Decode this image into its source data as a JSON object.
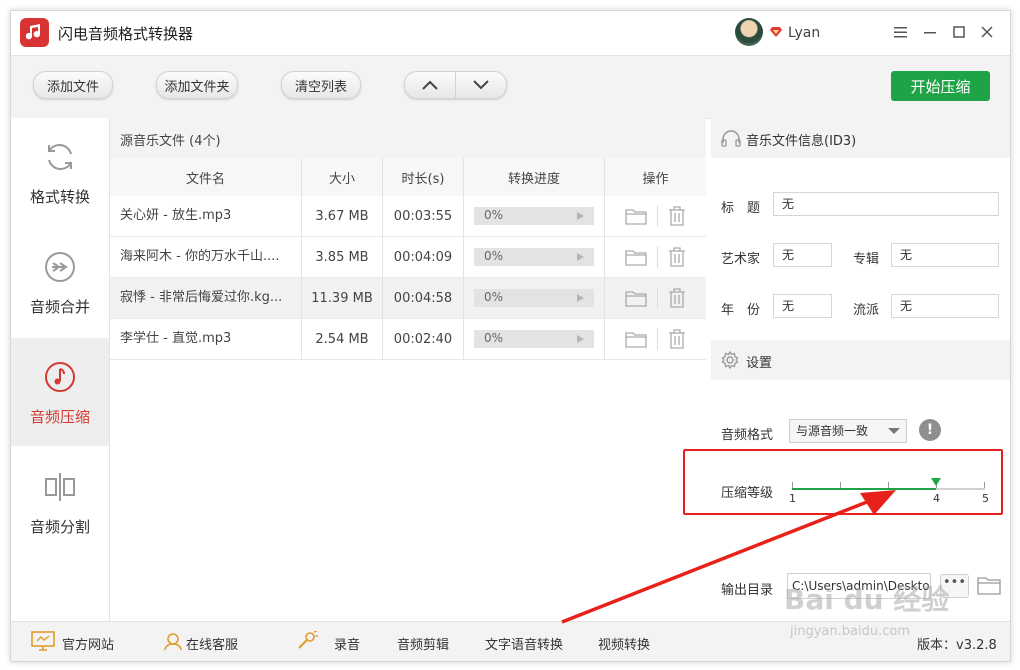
{
  "app": {
    "title": "闪电音频格式转换器",
    "user": "Lyan"
  },
  "toolbar": {
    "add_file": "添加文件",
    "add_folder": "添加文件夹",
    "clear_list": "清空列表",
    "start": "开始压缩"
  },
  "sidebar": {
    "items": [
      {
        "label": "格式转换"
      },
      {
        "label": "音频合并"
      },
      {
        "label": "音频压缩"
      },
      {
        "label": "音频分割"
      }
    ]
  },
  "filelist": {
    "title": "源音乐文件 (4个)",
    "columns": [
      "文件名",
      "大小",
      "时长(s)",
      "转换进度",
      "操作"
    ],
    "rows": [
      {
        "name": "关心妍 - 放生.mp3",
        "size": "3.67 MB",
        "duration": "00:03:55",
        "progress": "0%"
      },
      {
        "name": "海来阿木 - 你的万水千山....",
        "size": "3.85 MB",
        "duration": "00:04:09",
        "progress": "0%"
      },
      {
        "name": "寂悸 - 非常后悔爱过你.kg...",
        "size": "11.39 MB",
        "duration": "00:04:58",
        "progress": "0%"
      },
      {
        "name": "李学仕 - 直觉.mp3",
        "size": "2.54 MB",
        "duration": "00:02:40",
        "progress": "0%"
      }
    ]
  },
  "id3": {
    "header": "音乐文件信息(ID3)",
    "title_label": "标　题",
    "title_value": "无",
    "artist_label": "艺术家",
    "artist_value": "无",
    "album_label": "专辑",
    "album_value": "无",
    "year_label": "年　份",
    "year_value": "无",
    "genre_label": "流派",
    "genre_value": "无"
  },
  "settings": {
    "header": "设置",
    "format_label": "音频格式",
    "format_value": "与源音频一致",
    "level_label": "压缩等级",
    "level_min": "1",
    "level_max": "5",
    "level_value": "4",
    "level_value_num": 4,
    "output_label": "输出目录",
    "output_path": "C:\\Users\\admin\\Desktop",
    "more_label": "•••"
  },
  "bottom": {
    "website": "官方网站",
    "support": "在线客服",
    "record": "录音",
    "audio_cut": "音频剪辑",
    "tts": "文字语音转换",
    "video_convert": "视频转换",
    "version": "版本：v3.2.8"
  },
  "watermark": {
    "brand": "Bai du 经验",
    "url": "jingyan.baidu.com"
  },
  "colors": {
    "accent_green": "#1fa347",
    "active_red": "#d23b34",
    "annotation_red": "#e8211b"
  }
}
